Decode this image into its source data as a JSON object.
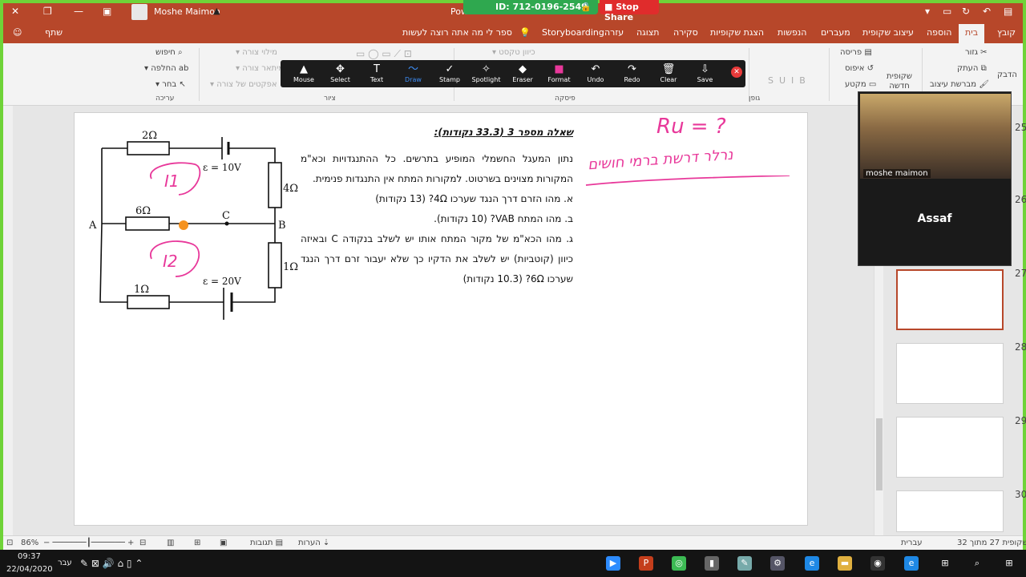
{
  "titlebar": {
    "user_name": "Moshe Maimon",
    "doc_title_short": "Pow",
    "zoom_id": "ID: 712-0196-2549",
    "stop_share": "Stop Share"
  },
  "tabs": [
    "קובץ",
    "בית",
    "הוספה",
    "עיצוב שקופית",
    "מעברים",
    "הנפשות",
    "הצגת שקופיות",
    "סקירה",
    "תצוגה",
    "עזרה",
    "Storyboarding"
  ],
  "tell_me": "ספר לי מה אתה רוצה לעשות",
  "share": "שתף",
  "ribbon": {
    "clipboard": {
      "paste": "הדבק",
      "cut": "גזור",
      "copy": "העתק",
      "format_painter": "מברשת עיצוב"
    },
    "slides": {
      "new_slide": "שקופית חדשה",
      "layout": "פריסה",
      "reset": "איפוס",
      "section": "מקטע"
    },
    "font_label": "גופן",
    "paragraph_label": "פיסקה",
    "paragraph_item": "כיוון טקסט",
    "drawing_label": "ציור",
    "drawing_items": [
      "מילוי צורה",
      "מיתאר צורה",
      "אפקטים של צורה"
    ],
    "editing_label": "עריכה",
    "editing_items": [
      "חיפוש",
      "החלפה",
      "בחר"
    ]
  },
  "annotation_toolbar": [
    {
      "label": "Mouse",
      "icon": "▲"
    },
    {
      "label": "Select",
      "icon": "✥"
    },
    {
      "label": "Text",
      "icon": "T"
    },
    {
      "label": "Draw",
      "icon": "〜"
    },
    {
      "label": "Stamp",
      "icon": "✓"
    },
    {
      "label": "Spotlight",
      "icon": "✧"
    },
    {
      "label": "Eraser",
      "icon": "◆"
    },
    {
      "label": "Format",
      "icon": "■"
    },
    {
      "label": "Undo",
      "icon": "↶"
    },
    {
      "label": "Redo",
      "icon": "↷"
    },
    {
      "label": "Clear",
      "icon": "🗑"
    },
    {
      "label": "Save",
      "icon": "⇩"
    }
  ],
  "slide": {
    "question_title": "שאלה מספר 3 (33.3 נקודות):",
    "paragraph": "נתון המעגל החשמלי המופיע בתרשים. כל ההתנגדויות וכא\"מ המקורות מצוינים בשרטוט. למקורות המתח אין התנגדות פנימית.",
    "part_a": "א. מהו הזרם דרך הנגד שערכו 4Ω? (13 נקודות)",
    "part_b": "ב. מהו המתח VAB? (10 נקודות).",
    "part_c": "ג. מהו הכא\"מ של מקור המתח אותו יש לשלב בנקודה C ובאיזה כיוון (קוטביות) יש לשלב את הדקיו כך שלא יעבור זרם דרך הנגד שערכו 6Ω? (10.3 נקודות)",
    "circuit": {
      "r_top": "2Ω",
      "emf_top": "ε = 10V",
      "r_right_top": "4Ω",
      "r_mid": "6Ω",
      "node_a": "A",
      "node_b": "B",
      "node_c": "C",
      "r_right_bot": "1Ω",
      "r_bottom": "1Ω",
      "emf_bot": "ε = 20V",
      "i1": "I1",
      "i2": "I2"
    },
    "handwriting_top": "Ru = ?",
    "handwriting_line": "נרלר דרשת ברמי חושים"
  },
  "video": {
    "participant_name": "moshe maimon",
    "other_name": "Assaf"
  },
  "thumbnails": [
    {
      "num": "27",
      "selected": true
    },
    {
      "num": "28",
      "selected": false
    },
    {
      "num": "29",
      "selected": false
    },
    {
      "num": "30",
      "selected": false
    }
  ],
  "side_numbers": [
    "25",
    "26"
  ],
  "status": {
    "slide_of": "שקופית 27 מתוך 32",
    "language": "עברית",
    "notes": "הערות",
    "comments": "תגובות",
    "zoom": "86%"
  },
  "taskbar": {
    "time": "09:37",
    "date": "22/04/2020",
    "lang": "עבר"
  },
  "colors": {
    "accent": "#b7472a",
    "zoom_green": "#6fd338",
    "pen": "#e8389a"
  }
}
